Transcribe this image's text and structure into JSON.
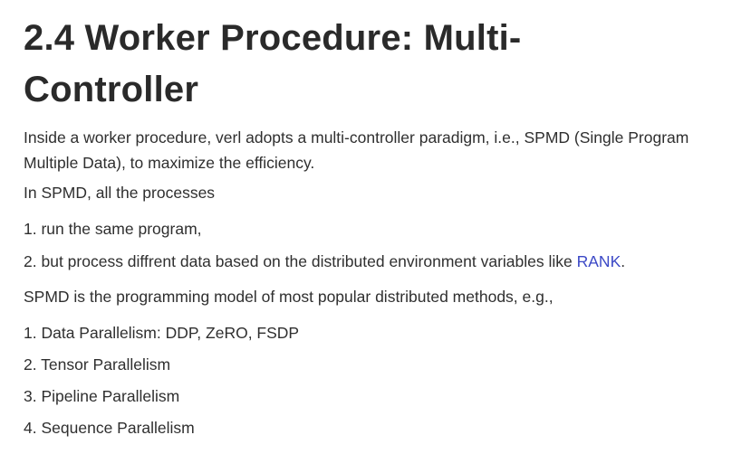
{
  "heading": "2.4 Worker Procedure: Multi-Controller",
  "paragraphs": {
    "intro": "Inside a worker procedure, verl adopts a multi-controller paradigm, i.e., SPMD (Single Program Multiple Data), to maximize the efficiency.",
    "spmd_lead": "In SPMD, all the processes",
    "spmd_model": "SPMD is the programming model of most popular distributed methods, e.g.,"
  },
  "process_steps": [
    {
      "number": "1.",
      "text": "run the same program,"
    },
    {
      "number": "2.",
      "text": "but process diffrent data based on the distributed environment variables like ",
      "link": "RANK",
      "suffix": "."
    }
  ],
  "methods": [
    {
      "number": "1.",
      "text": "Data Parallelism: DDP, ZeRO, FSDP"
    },
    {
      "number": "2.",
      "text": "Tensor Parallelism"
    },
    {
      "number": "3.",
      "text": "Pipeline Parallelism"
    },
    {
      "number": "4.",
      "text": "Sequence Parallelism"
    }
  ],
  "colors": {
    "text": "#2f2f2f",
    "heading": "#2a2a2a",
    "link": "#3b48c6",
    "background": "#ffffff"
  }
}
